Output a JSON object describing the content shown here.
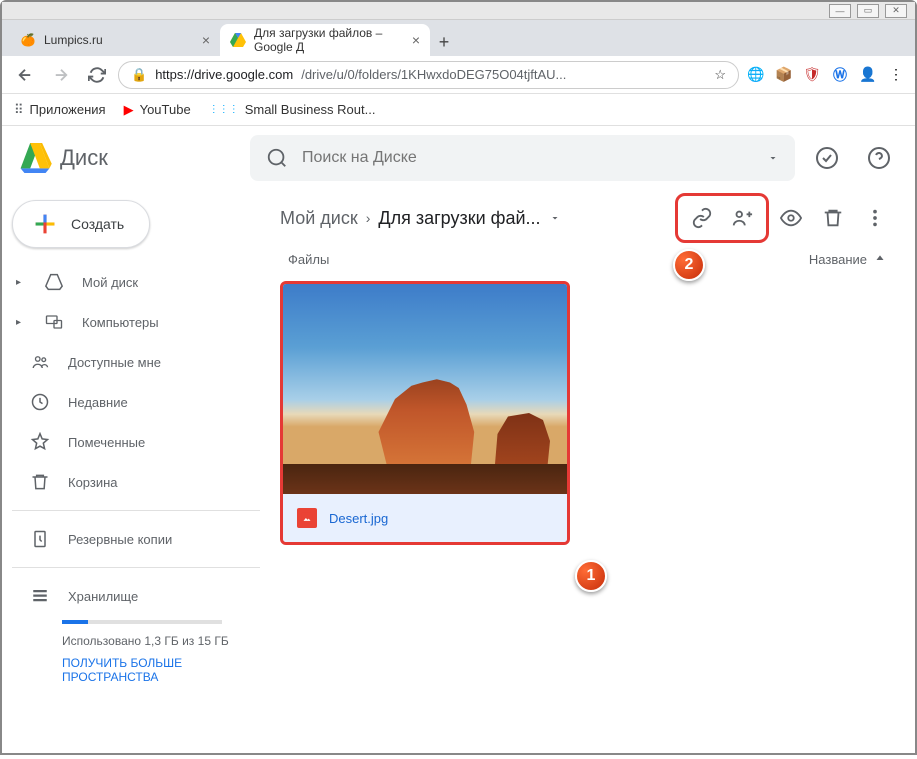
{
  "window": {
    "minimize": "—",
    "maximize": "▭",
    "close": "✕"
  },
  "tabs": [
    {
      "title": "Lumpics.ru",
      "favicon": "🍊"
    },
    {
      "title": "Для загрузки файлов – Google Д",
      "favicon": "drive"
    }
  ],
  "browser": {
    "url_lock": "🔒",
    "url_host": "https://drive.google.com",
    "url_path": "/drive/u/0/folders/1KHwxdoDEG75O04tjftAU...",
    "star": "☆"
  },
  "bookmarks": [
    {
      "icon": "⠿",
      "label": "Приложения"
    },
    {
      "icon": "▶",
      "label": "YouTube",
      "color": "#f00"
    },
    {
      "icon": "⋮⋮",
      "label": "Small Business Rout...",
      "color": "#0af"
    }
  ],
  "drive": {
    "logo_text": "Диск",
    "search_placeholder": "Поиск на Диске",
    "create_label": "Создать"
  },
  "sidebar": [
    {
      "icon": "drive",
      "label": "Мой диск",
      "expandable": true
    },
    {
      "icon": "devices",
      "label": "Компьютеры",
      "expandable": true
    },
    {
      "icon": "shared",
      "label": "Доступные мне"
    },
    {
      "icon": "recent",
      "label": "Недавние"
    },
    {
      "icon": "star",
      "label": "Помеченные"
    },
    {
      "icon": "trash",
      "label": "Корзина"
    },
    {
      "icon": "backup",
      "label": "Резервные копии"
    },
    {
      "icon": "storage",
      "label": "Хранилище"
    }
  ],
  "storage": {
    "used_text": "Использовано 1,3 ГБ из 15 ГБ",
    "upgrade_text": "ПОЛУЧИТЬ БОЛЬШЕ ПРОСТРАНСТВА"
  },
  "breadcrumb": {
    "root": "Мой диск",
    "current": "Для загрузки фай..."
  },
  "section": {
    "files_label": "Файлы",
    "sort_label": "Название"
  },
  "file": {
    "name": "Desert.jpg"
  },
  "annotations": {
    "one": "1",
    "two": "2"
  }
}
